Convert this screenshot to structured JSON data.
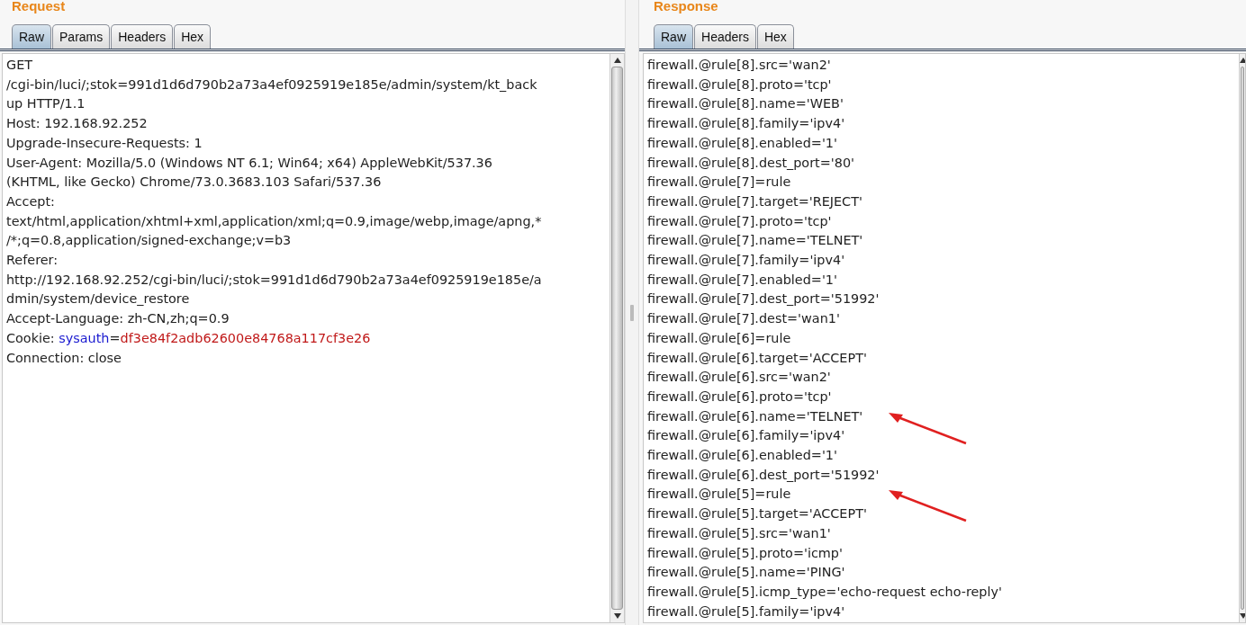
{
  "request": {
    "title": "Request",
    "tabs": [
      {
        "label": "Raw",
        "selected": true
      },
      {
        "label": "Params",
        "selected": false
      },
      {
        "label": "Headers",
        "selected": false
      },
      {
        "label": "Hex",
        "selected": false
      }
    ],
    "lines": [
      [
        {
          "text": "GET",
          "kind": "plain"
        }
      ],
      [
        {
          "text": "/cgi-bin/luci/;stok=991d1d6d790b2a73a4ef0925919e185e/admin/system/kt_back",
          "kind": "plain"
        }
      ],
      [
        {
          "text": "up HTTP/1.1",
          "kind": "plain"
        }
      ],
      [
        {
          "text": "Host: 192.168.92.252",
          "kind": "plain"
        }
      ],
      [
        {
          "text": "Upgrade-Insecure-Requests: 1",
          "kind": "plain"
        }
      ],
      [
        {
          "text": "User-Agent: Mozilla/5.0 (Windows NT 6.1; Win64; x64) AppleWebKit/537.36",
          "kind": "plain"
        }
      ],
      [
        {
          "text": "(KHTML, like Gecko) Chrome/73.0.3683.103 Safari/537.36",
          "kind": "plain"
        }
      ],
      [
        {
          "text": "Accept:",
          "kind": "plain"
        }
      ],
      [
        {
          "text": "text/html,application/xhtml+xml,application/xml;q=0.9,image/webp,image/apng,*",
          "kind": "plain"
        }
      ],
      [
        {
          "text": "/*;q=0.8,application/signed-exchange;v=b3",
          "kind": "plain"
        }
      ],
      [
        {
          "text": "Referer:",
          "kind": "plain"
        }
      ],
      [
        {
          "text": "http://192.168.92.252/cgi-bin/luci/;stok=991d1d6d790b2a73a4ef0925919e185e/a",
          "kind": "plain"
        }
      ],
      [
        {
          "text": "dmin/system/device_restore",
          "kind": "plain"
        }
      ],
      [
        {
          "text": "Accept-Language: zh-CN,zh;q=0.9",
          "kind": "plain"
        }
      ],
      [
        {
          "text": "Cookie: ",
          "kind": "plain"
        },
        {
          "text": "sysauth",
          "kind": "name"
        },
        {
          "text": "=",
          "kind": "plain"
        },
        {
          "text": "df3e84f2adb62600e84768a117cf3e26",
          "kind": "value"
        }
      ],
      [
        {
          "text": "Connection: close",
          "kind": "plain"
        }
      ]
    ]
  },
  "response": {
    "title": "Response",
    "tabs": [
      {
        "label": "Raw",
        "selected": true
      },
      {
        "label": "Headers",
        "selected": false
      },
      {
        "label": "Hex",
        "selected": false
      }
    ],
    "lines": [
      {
        "text": "firewall.@rule[8].src='wan2'",
        "arrow": false
      },
      {
        "text": "firewall.@rule[8].proto='tcp'",
        "arrow": false
      },
      {
        "text": "firewall.@rule[8].name='WEB'",
        "arrow": false
      },
      {
        "text": "firewall.@rule[8].family='ipv4'",
        "arrow": false
      },
      {
        "text": "firewall.@rule[8].enabled='1'",
        "arrow": false
      },
      {
        "text": "firewall.@rule[8].dest_port='80'",
        "arrow": false
      },
      {
        "text": "firewall.@rule[7]=rule",
        "arrow": false
      },
      {
        "text": "firewall.@rule[7].target='REJECT'",
        "arrow": false
      },
      {
        "text": "firewall.@rule[7].proto='tcp'",
        "arrow": false
      },
      {
        "text": "firewall.@rule[7].name='TELNET'",
        "arrow": false
      },
      {
        "text": "firewall.@rule[7].family='ipv4'",
        "arrow": false
      },
      {
        "text": "firewall.@rule[7].enabled='1'",
        "arrow": false
      },
      {
        "text": "firewall.@rule[7].dest_port='51992'",
        "arrow": false
      },
      {
        "text": "firewall.@rule[7].dest='wan1'",
        "arrow": false
      },
      {
        "text": "firewall.@rule[6]=rule",
        "arrow": false
      },
      {
        "text": "firewall.@rule[6].target='ACCEPT'",
        "arrow": false
      },
      {
        "text": "firewall.@rule[6].src='wan2'",
        "arrow": false
      },
      {
        "text": "firewall.@rule[6].proto='tcp'",
        "arrow": false
      },
      {
        "text": "firewall.@rule[6].name='TELNET'",
        "arrow": true
      },
      {
        "text": "firewall.@rule[6].family='ipv4'",
        "arrow": false
      },
      {
        "text": "firewall.@rule[6].enabled='1'",
        "arrow": false
      },
      {
        "text": "firewall.@rule[6].dest_port='51992'",
        "arrow": false
      },
      {
        "text": "firewall.@rule[5]=rule",
        "arrow": true
      },
      {
        "text": "firewall.@rule[5].target='ACCEPT'",
        "arrow": false
      },
      {
        "text": "firewall.@rule[5].src='wan1'",
        "arrow": false
      },
      {
        "text": "firewall.@rule[5].proto='icmp'",
        "arrow": false
      },
      {
        "text": "firewall.@rule[5].name='PING'",
        "arrow": false
      },
      {
        "text": "firewall.@rule[5].icmp_type='echo-request echo-reply'",
        "arrow": false
      },
      {
        "text": "firewall.@rule[5].family='ipv4'",
        "arrow": false
      }
    ]
  }
}
